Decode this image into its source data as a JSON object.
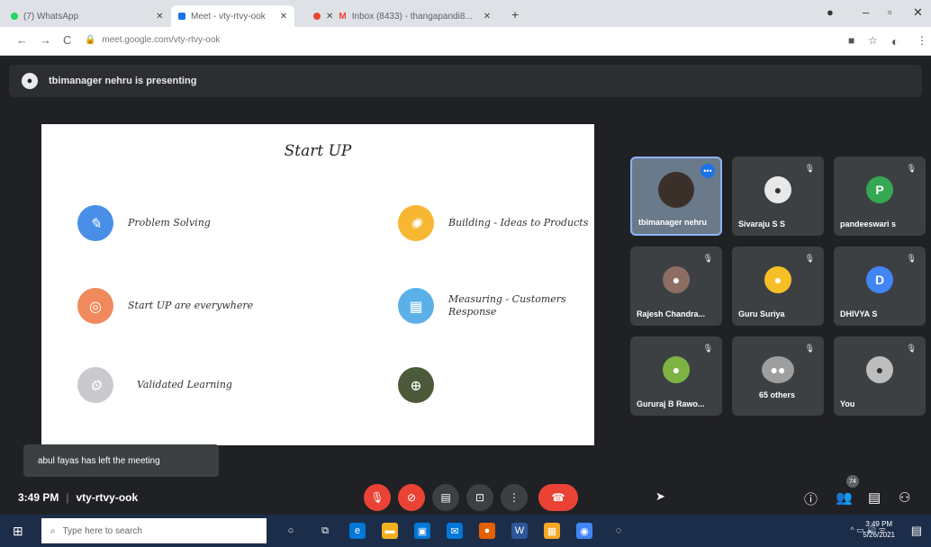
{
  "browser": {
    "tabs": [
      {
        "label": "(7) WhatsApp",
        "color": "#25d366"
      },
      {
        "label": "Meet - vty-rtvy-ook",
        "color": "#1a73e8"
      },
      {
        "label": "Inbox (8433) - thangapandi8...",
        "color": "#ea4335"
      }
    ],
    "url": "meet.google.com/vty-rtvy-ook"
  },
  "meet": {
    "presenting_text": "tbimanager nehru is presenting",
    "slide": {
      "title": "Start UP",
      "items": [
        {
          "label": "Problem Solving",
          "color": "#4a8fe7",
          "icon": "puzzle-icon"
        },
        {
          "label": "Start UP are everywhere",
          "color": "#f08a5d",
          "icon": "target-icon"
        },
        {
          "label": "Validated Learning",
          "color": "#c9c9cf",
          "icon": "gear-icon"
        },
        {
          "label": "Building - Ideas to Products",
          "color": "#f7b733",
          "icon": "idea-icon"
        },
        {
          "label": "Measuring - Customers Response",
          "color": "#5bb0e8",
          "icon": "chart-icon"
        },
        {
          "label": "",
          "color": "#4a5a3a",
          "icon": "globe-icon"
        }
      ]
    },
    "participants": [
      {
        "name": "tbimanager nehru",
        "initial": "",
        "color": "#6b7a8a"
      },
      {
        "name": "Sivaraju S S",
        "initial": "",
        "color": "#5f6368"
      },
      {
        "name": "pandeeswari s",
        "initial": "P",
        "color": "#34a853"
      },
      {
        "name": "Rajesh Chandra...",
        "initial": "",
        "color": "#8d6e63"
      },
      {
        "name": "Guru Suriya",
        "initial": "",
        "color": "#f6bf26"
      },
      {
        "name": "DHIVYA S",
        "initial": "D",
        "color": "#4285f4"
      },
      {
        "name": "Gururaj B Rawo...",
        "initial": "",
        "color": "#7cb342"
      },
      {
        "name": "65 others",
        "initial": "",
        "color": "#9e9e9e"
      },
      {
        "name": "You",
        "initial": "",
        "color": "#bdbdbd"
      }
    ],
    "toast": "abul fayas has left the meeting",
    "time": "3:49 PM",
    "meeting_code": "vty-rtvy-ook",
    "people_count": "74"
  },
  "taskbar": {
    "search_placeholder": "Type here to search",
    "clock_time": "3:49 PM",
    "clock_date": "5/26/2021"
  }
}
